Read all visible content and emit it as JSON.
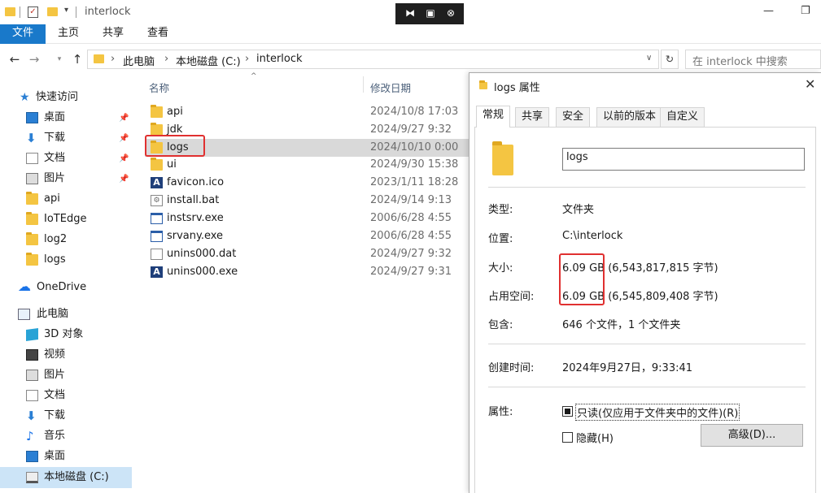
{
  "window": {
    "title": "interlock"
  },
  "ribbon": {
    "tabs": [
      "文件",
      "主页",
      "共享",
      "查看"
    ]
  },
  "address": {
    "crumbs": [
      "此电脑",
      "本地磁盘 (C:)",
      "interlock"
    ],
    "search_placeholder": "在 interlock 中搜索"
  },
  "sidebar": {
    "quick_access": "快速访问",
    "items": [
      {
        "label": "桌面",
        "icon": "desktop-icon",
        "pinned": true
      },
      {
        "label": "下载",
        "icon": "download-icon",
        "pinned": true
      },
      {
        "label": "文档",
        "icon": "document-icon",
        "pinned": true
      },
      {
        "label": "图片",
        "icon": "picture-icon",
        "pinned": true
      },
      {
        "label": "api",
        "icon": "folder-icon"
      },
      {
        "label": "IoTEdge",
        "icon": "folder-icon"
      },
      {
        "label": "log2",
        "icon": "folder-icon"
      },
      {
        "label": "logs",
        "icon": "folder-icon"
      }
    ],
    "onedrive": "OneDrive",
    "this_pc": "此电脑",
    "pc_items": [
      {
        "label": "3D 对象",
        "icon": "3d-objects-icon"
      },
      {
        "label": "视频",
        "icon": "video-icon"
      },
      {
        "label": "图片",
        "icon": "picture-icon"
      },
      {
        "label": "文档",
        "icon": "document-icon"
      },
      {
        "label": "下载",
        "icon": "download-icon"
      },
      {
        "label": "音乐",
        "icon": "music-icon"
      },
      {
        "label": "桌面",
        "icon": "desktop-icon"
      },
      {
        "label": "本地磁盘 (C:)",
        "icon": "drive-icon",
        "selected": true
      }
    ]
  },
  "filelist": {
    "columns": {
      "name": "名称",
      "modified": "修改日期"
    },
    "rows": [
      {
        "name": "api",
        "date": "2024/10/8 17:03",
        "icon": "folder-icon"
      },
      {
        "name": "jdk",
        "date": "2024/9/27 9:32",
        "icon": "folder-icon"
      },
      {
        "name": "logs",
        "date": "2024/10/10 0:00",
        "icon": "folder-icon",
        "selected": true
      },
      {
        "name": "ui",
        "date": "2024/9/30 15:38",
        "icon": "folder-icon"
      },
      {
        "name": "favicon.ico",
        "date": "2023/1/11 18:28",
        "icon": "app-icon"
      },
      {
        "name": "install.bat",
        "date": "2024/9/14 9:13",
        "icon": "gear-file-icon"
      },
      {
        "name": "instsrv.exe",
        "date": "2006/6/28 4:55",
        "icon": "window-file-icon"
      },
      {
        "name": "srvany.exe",
        "date": "2006/6/28 4:55",
        "icon": "window-file-icon"
      },
      {
        "name": "unins000.dat",
        "date": "2024/9/27 9:32",
        "icon": "blank-file-icon"
      },
      {
        "name": "unins000.exe",
        "date": "2024/9/27 9:31",
        "icon": "app-icon"
      }
    ]
  },
  "dialog": {
    "title": "logs 属性",
    "tabs": [
      "常规",
      "共享",
      "安全",
      "以前的版本",
      "自定义"
    ],
    "name_value": "logs",
    "type_label": "类型:",
    "type_value": "文件夹",
    "location_label": "位置:",
    "location_value": "C:\\interlock",
    "size_label": "大小:",
    "size_value": "6.09 GB (6,543,817,815 字节)",
    "disk_label": "占用空间:",
    "disk_value": "6.09 GB (6,545,809,408 字节)",
    "contains_label": "包含:",
    "contains_value": "646 个文件，1 个文件夹",
    "created_label": "创建时间:",
    "created_value": "2024年9月27日，9:33:41",
    "attr_label": "属性:",
    "readonly_label": "只读(仅应用于文件夹中的文件)(R)",
    "hidden_label": "隐藏(H)",
    "advanced_label": "高级(D)..."
  }
}
